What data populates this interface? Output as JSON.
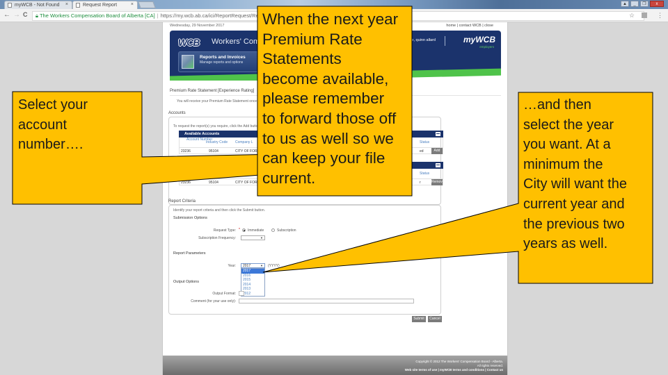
{
  "browser": {
    "tabs": [
      {
        "label": "myWCB - Not Found",
        "active": false
      },
      {
        "label": "Request Report",
        "active": true
      }
    ],
    "address": {
      "org": "The Workers Compensation Board of Alberta [CA]",
      "url": "https://my.wcb.ab.ca/ici/ReportRequest/Reque"
    },
    "nav": {
      "back": "←",
      "forward": "→",
      "reload": "C"
    },
    "icons": {
      "star": "☆",
      "menu": "⋮"
    }
  },
  "page": {
    "date": "Wednesday, 29 November 2017",
    "top_links": "home | contact WCB | close",
    "banner": {
      "logo": "WCB",
      "title": "Workers' Compensation Board",
      "section_title": "Reports and Invoices",
      "section_subtitle": "Manage reports and options",
      "welcome": "Welcome, quinn allard",
      "brand": "myWCB",
      "brand_sub": "employers"
    },
    "report_title": "Premium Rate Statement [Experience Rating]",
    "report_intro": "You will receive your Premium Rate Statement once the report has been processed and is ready.",
    "accounts": {
      "heading": "Accounts",
      "instruction": "To request the report(s) you require, click the Add button",
      "available": {
        "title": "Available Accounts",
        "columns": [
          "Account Number",
          "Industry Code",
          "Company L",
          "Status",
          ""
        ],
        "rows": [
          {
            "account": "23236",
            "industry": "95104",
            "company": "CITY OF FORT S",
            "status": "ed",
            "action": "Add"
          }
        ]
      },
      "selected": {
        "title": "",
        "columns": [
          "",
          "",
          "Company L",
          "Status",
          ""
        ],
        "rows": [
          {
            "account": "23236",
            "industry": "95104",
            "company": "CITY OF FORT S",
            "status": "r",
            "action": "Remove"
          }
        ]
      }
    },
    "criteria": {
      "heading": "Report Criteria",
      "instruction": "Identify your report criteria and then click the Submit button.",
      "submission_options": "Submission Options",
      "request_type_label": "Request Type:",
      "request_type_required": "*",
      "request_type_options": [
        {
          "label": "Immediate",
          "selected": true
        },
        {
          "label": "Subscription",
          "selected": false
        }
      ],
      "subscription_frequency_label": "Subscription Frequency:",
      "subscription_frequency_value": "",
      "report_parameters": "Report Parameters",
      "year_label": "Year:",
      "year_value": "2017",
      "year_hint": "(YYYY)",
      "year_options": [
        "2017",
        "2016",
        "2015",
        "2014",
        "2013",
        "2012"
      ],
      "year_highlighted": "2017",
      "output_options": "Output Options",
      "output_format_label": "Output Format:",
      "comment_label": "Comment (for your use only):",
      "comment_value": ""
    },
    "buttons": {
      "submit": "Submit",
      "cancel": "Cancel"
    },
    "footer": {
      "copyright": "Copyright © 2012 The Workers' Compensation Board - Alberta.",
      "rights": "All rights reserved.",
      "links": "Web site terms of use | myWCB terms and conditions | Contact us"
    }
  },
  "callouts": {
    "left": {
      "lines": [
        "Select your",
        "account",
        "number…."
      ]
    },
    "center": {
      "lines": [
        "When the next year",
        "Premium Rate",
        "Statements",
        "become available,",
        "please remember",
        "to forward those off",
        "to us as well so we",
        "can keep your file",
        "current."
      ]
    },
    "right": {
      "lines": [
        "…and then",
        "select the year",
        "you want. At a",
        "minimum the",
        "City will want the",
        "current year and",
        "the previous two",
        "years as well."
      ]
    },
    "fill_color": "#FFC000",
    "stroke_color": "#000000"
  }
}
